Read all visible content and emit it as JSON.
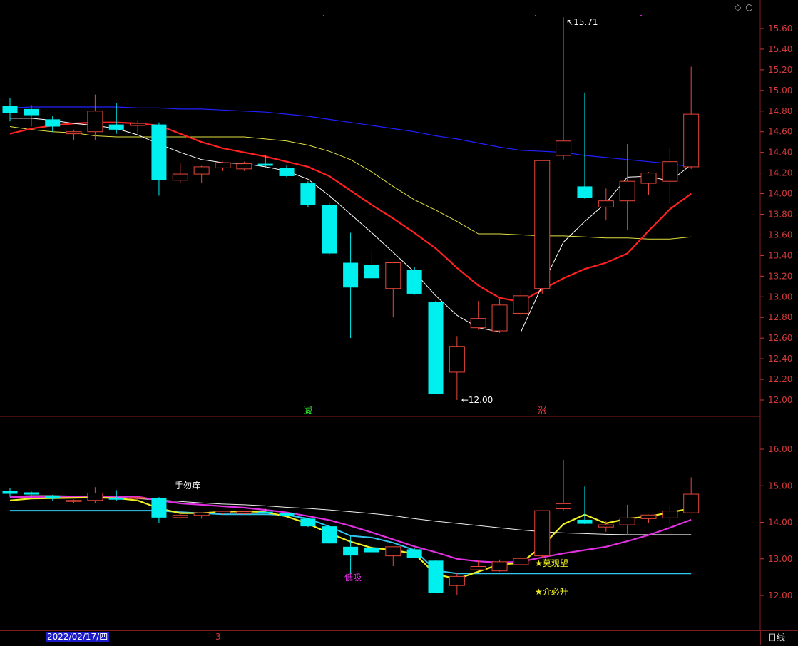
{
  "toolbar": {
    "period_label": "日线",
    "selected_date": "2022/02/17/四",
    "marker_label": "3",
    "icon_names": [
      "diamond-icon",
      "circle-icon"
    ]
  },
  "colors": {
    "up": "#e8463a",
    "down": "#00f0f0",
    "axis": "#d23a3a",
    "ma5": "#ffffff",
    "ma10": "#ff2020",
    "ma20": "#e0e040",
    "ma60": "#2020ff"
  },
  "chart_data": [
    {
      "type": "candlestick",
      "title": "",
      "ylim": [
        11.9,
        15.75
      ],
      "yticks": [
        "15.60",
        "15.40",
        "15.20",
        "15.00",
        "14.80",
        "14.60",
        "14.40",
        "14.20",
        "14.00",
        "13.80",
        "13.60",
        "13.40",
        "13.20",
        "13.00",
        "12.80",
        "12.60",
        "12.40",
        "12.20",
        "12.00"
      ],
      "candles": [
        {
          "o": 14.85,
          "h": 14.93,
          "l": 14.7,
          "c": 14.78
        },
        {
          "o": 14.82,
          "h": 14.86,
          "l": 14.65,
          "c": 14.76
        },
        {
          "o": 14.72,
          "h": 14.75,
          "l": 14.6,
          "c": 14.65
        },
        {
          "o": 14.58,
          "h": 14.62,
          "l": 14.52,
          "c": 14.6
        },
        {
          "o": 14.6,
          "h": 14.96,
          "l": 14.52,
          "c": 14.8
        },
        {
          "o": 14.67,
          "h": 14.88,
          "l": 14.58,
          "c": 14.62
        },
        {
          "o": 14.66,
          "h": 14.71,
          "l": 14.59,
          "c": 14.68
        },
        {
          "o": 14.67,
          "h": 14.69,
          "l": 13.98,
          "c": 14.13
        },
        {
          "o": 14.13,
          "h": 14.3,
          "l": 14.1,
          "c": 14.19
        },
        {
          "o": 14.19,
          "h": 14.27,
          "l": 14.1,
          "c": 14.26
        },
        {
          "o": 14.25,
          "h": 14.31,
          "l": 14.22,
          "c": 14.3
        },
        {
          "o": 14.24,
          "h": 14.31,
          "l": 14.22,
          "c": 14.29
        },
        {
          "o": 14.29,
          "h": 14.37,
          "l": 14.25,
          "c": 14.27
        },
        {
          "o": 14.25,
          "h": 14.28,
          "l": 14.16,
          "c": 14.17
        },
        {
          "o": 14.1,
          "h": 14.12,
          "l": 13.87,
          "c": 13.89
        },
        {
          "o": 13.89,
          "h": 13.91,
          "l": 13.41,
          "c": 13.42
        },
        {
          "o": 13.33,
          "h": 13.62,
          "l": 12.6,
          "c": 13.09
        },
        {
          "o": 13.31,
          "h": 13.45,
          "l": 13.18,
          "c": 13.18
        },
        {
          "o": 13.08,
          "h": 13.33,
          "l": 12.8,
          "c": 13.33
        },
        {
          "o": 13.26,
          "h": 13.29,
          "l": 13.02,
          "c": 13.03
        },
        {
          "o": 12.95,
          "h": 12.96,
          "l": 12.06,
          "c": 12.06
        },
        {
          "o": 12.27,
          "h": 12.62,
          "l": 12.0,
          "c": 12.52
        },
        {
          "o": 12.7,
          "h": 12.96,
          "l": 12.68,
          "c": 12.79
        },
        {
          "o": 12.67,
          "h": 12.98,
          "l": 12.65,
          "c": 12.92
        },
        {
          "o": 12.84,
          "h": 13.07,
          "l": 12.8,
          "c": 13.01
        },
        {
          "o": 13.08,
          "h": 14.32,
          "l": 13.03,
          "c": 14.32
        },
        {
          "o": 14.37,
          "h": 15.71,
          "l": 14.33,
          "c": 14.51
        },
        {
          "o": 14.07,
          "h": 14.98,
          "l": 13.95,
          "c": 13.96
        },
        {
          "o": 13.87,
          "h": 14.05,
          "l": 13.74,
          "c": 13.93
        },
        {
          "o": 13.93,
          "h": 14.48,
          "l": 13.65,
          "c": 14.12
        },
        {
          "o": 14.1,
          "h": 14.21,
          "l": 13.99,
          "c": 14.2
        },
        {
          "o": 14.12,
          "h": 14.44,
          "l": 13.9,
          "c": 14.31
        },
        {
          "o": 14.26,
          "h": 15.23,
          "l": 14.24,
          "c": 14.77
        }
      ],
      "ma5": [
        14.73,
        14.73,
        14.71,
        14.68,
        14.66,
        14.63,
        14.57,
        14.48,
        14.4,
        14.33,
        14.3,
        14.29,
        14.26,
        14.22,
        14.14,
        13.98,
        13.8,
        13.62,
        13.43,
        13.24,
        13.01,
        12.82,
        12.7,
        12.66,
        12.66,
        13.11,
        13.53,
        13.73,
        13.91,
        14.16,
        14.17,
        14.12,
        14.28
      ],
      "ma10": [
        14.58,
        14.63,
        14.66,
        14.68,
        14.69,
        14.69,
        14.68,
        14.66,
        14.58,
        14.5,
        14.44,
        14.4,
        14.36,
        14.31,
        14.26,
        14.17,
        14.03,
        13.89,
        13.76,
        13.62,
        13.47,
        13.28,
        13.11,
        12.99,
        12.95,
        13.07,
        13.18,
        13.27,
        13.33,
        13.42,
        13.64,
        13.85,
        14.0
      ],
      "ma20": [
        14.65,
        14.62,
        14.6,
        14.59,
        14.56,
        14.55,
        14.55,
        14.55,
        14.55,
        14.55,
        14.55,
        14.55,
        14.53,
        14.51,
        14.47,
        14.41,
        14.33,
        14.21,
        14.07,
        13.94,
        13.84,
        13.73,
        13.61,
        13.61,
        13.6,
        13.59,
        13.59,
        13.58,
        13.57,
        13.57,
        13.56,
        13.56,
        13.58
      ],
      "ma60": [
        14.83,
        14.84,
        14.84,
        14.84,
        14.84,
        14.84,
        14.83,
        14.83,
        14.82,
        14.82,
        14.81,
        14.8,
        14.79,
        14.77,
        14.75,
        14.72,
        14.69,
        14.66,
        14.63,
        14.6,
        14.56,
        14.53,
        14.49,
        14.45,
        14.42,
        14.41,
        14.4,
        14.37,
        14.35,
        14.33,
        14.31,
        14.29,
        14.26
      ],
      "annotations": {
        "high": "15.71",
        "low": "12.00",
        "signal_reduce": "减",
        "signal_rise": "涨"
      }
    },
    {
      "type": "candlestick",
      "title": "",
      "ylim": [
        11.4,
        16.6
      ],
      "yticks": [
        "16.00",
        "15.00",
        "14.00",
        "13.00",
        "12.00"
      ],
      "white_line": [
        14.71,
        14.73,
        14.73,
        14.72,
        14.7,
        14.68,
        14.65,
        14.61,
        14.57,
        14.53,
        14.5,
        14.48,
        14.45,
        14.41,
        14.38,
        14.34,
        14.29,
        14.24,
        14.18,
        14.1,
        14.03,
        13.97,
        13.91,
        13.85,
        13.79,
        13.74,
        13.71,
        13.69,
        13.67,
        13.66,
        13.66,
        13.66,
        13.66
      ],
      "magenta_line": [
        14.69,
        14.69,
        14.7,
        14.7,
        14.7,
        14.7,
        14.7,
        14.6,
        14.52,
        14.48,
        14.44,
        14.4,
        14.34,
        14.27,
        14.17,
        14.06,
        13.9,
        13.72,
        13.53,
        13.34,
        13.18,
        13.0,
        12.93,
        12.9,
        12.92,
        13.04,
        13.15,
        13.24,
        13.33,
        13.48,
        13.65,
        13.85,
        14.07
      ],
      "yellow_line": [
        14.6,
        14.65,
        14.66,
        14.67,
        14.68,
        14.66,
        14.6,
        14.38,
        14.25,
        14.25,
        14.29,
        14.3,
        14.28,
        14.16,
        13.96,
        13.7,
        13.47,
        13.3,
        13.24,
        13.14,
        12.58,
        12.45,
        12.65,
        12.85,
        12.88,
        13.35,
        13.95,
        14.21,
        13.97,
        14.1,
        14.16,
        14.27,
        14.38
      ],
      "cyan_line": [
        14.32,
        14.32,
        14.32,
        14.32,
        14.32,
        14.32,
        14.32,
        14.32,
        14.28,
        14.25,
        14.22,
        14.22,
        14.22,
        14.2,
        14.1,
        13.88,
        13.63,
        13.58,
        13.44,
        13.24,
        12.68,
        12.6,
        12.6,
        12.6,
        12.6,
        12.6,
        12.6,
        12.6,
        12.6,
        12.6,
        12.6,
        12.6,
        12.6
      ],
      "annotations": {
        "hold": "手勿痒",
        "buy_low": "低吸",
        "wait": "★莫观望",
        "rise": "★介必升"
      }
    }
  ]
}
